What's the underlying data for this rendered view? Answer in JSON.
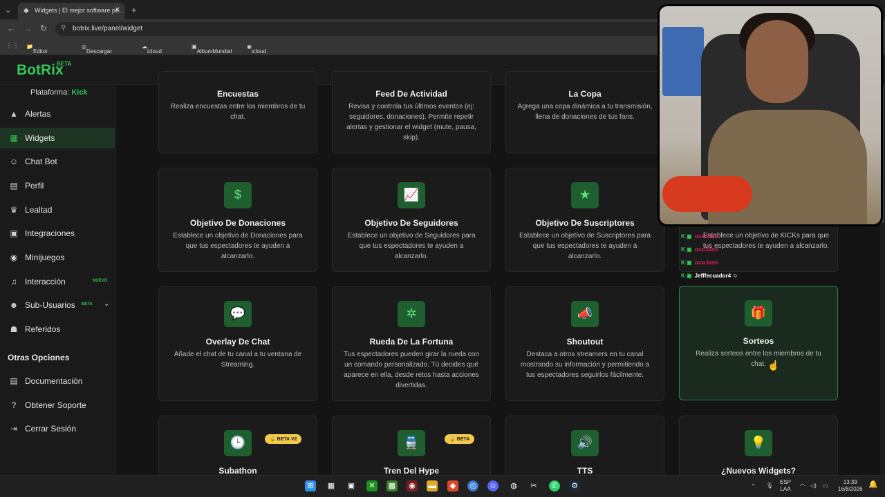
{
  "browser": {
    "tab_title": "Widgets | El mejor software pa…",
    "url": "botrix.live/panel/widget",
    "bookmarks": [
      "Editor de Fotos",
      "Descargar stream",
      "icloud correo",
      "AlbumMundial",
      "icloud photos"
    ]
  },
  "brand": {
    "name": "BotRix",
    "beta": "BETA"
  },
  "sidebar": {
    "platform_label": "Plataforma:",
    "platform_value": "Kick",
    "items": [
      {
        "label": "Alertas",
        "icon": "warning-icon"
      },
      {
        "label": "Widgets",
        "icon": "grid-icon"
      },
      {
        "label": "Chat Bot",
        "icon": "robot-icon"
      },
      {
        "label": "Perfil",
        "icon": "id-card-icon"
      },
      {
        "label": "Lealtad",
        "icon": "trophy-icon"
      },
      {
        "label": "Integraciones",
        "icon": "plug-icon"
      },
      {
        "label": "Minijuegos",
        "icon": "gamepad-icon"
      },
      {
        "label": "Interacción",
        "icon": "music-icon",
        "tag": "NUEVO"
      },
      {
        "label": "Sub-Usuarios",
        "icon": "users-icon",
        "tag": "BETA"
      },
      {
        "label": "Referidos",
        "icon": "user-group-icon"
      }
    ],
    "other_title": "Otras Opciones",
    "other_items": [
      {
        "label": "Documentación",
        "icon": "document-icon"
      },
      {
        "label": "Obtener Soporte",
        "icon": "help-icon"
      },
      {
        "label": "Cerrar Sesión",
        "icon": "logout-icon"
      }
    ]
  },
  "widgets": {
    "row0": [
      {
        "title": "Encuestas",
        "desc": "Realiza encuestas entre los miembros de tu chat."
      },
      {
        "title": "Feed De Actividad",
        "desc": "Revisa y controla tus últimos eventos (ej: seguidores, donaciones). Permite repetir alertas y gestionar el widget (mute, pausa, skip)."
      },
      {
        "title": "La Copa",
        "desc": "Agrega una copa dinámica a tu transmisión, llena de donaciones de tus fans."
      }
    ],
    "row1": [
      {
        "title": "Objetivo De Donaciones",
        "desc": "Establece un objetivo de Donaciones para que tus espectadores te ayuden a alcanzarlo.",
        "icon": "$"
      },
      {
        "title": "Objetivo De Seguidores",
        "desc": "Establece un objetivo de Seguidores para que tus espectadores te ayuden a alcanzarlo.",
        "icon": "📈"
      },
      {
        "title": "Objetivo De Suscriptores",
        "desc": "Establece un objetivo de Suscriptores para que tus espectadores te ayuden a alcanzarlo.",
        "icon": "★"
      }
    ],
    "row1_obscured_desc": "Establece un objetivo de KICKs para que tus espectadores te ayuden a alcanzarlo.",
    "row2": [
      {
        "title": "Overlay De Chat",
        "desc": "Añade el chat de tu canal a tu ventana de Streaming.",
        "icon": "💬"
      },
      {
        "title": "Rueda De La Fortuna",
        "desc": "Tus espectadores pueden girar la rueda con un comando personalizado. Tú decides qué aparece en ella, desde retos hasta acciones divertidas.",
        "icon": "✲"
      },
      {
        "title": "Shoutout",
        "desc": "Destaca a otros streamers en tu canal mostrando su información y permitiendo a tus espectadores seguirlos fácilmente.",
        "icon": "📣"
      },
      {
        "title": "Sorteos",
        "desc": "Realiza sorteos entre los miembros de tu chat.",
        "icon": "🎁"
      }
    ],
    "row3": [
      {
        "title": "Subathon",
        "badge": "🔒 BETA V2",
        "icon": "🕒"
      },
      {
        "title": "Tren Del Hype",
        "badge": "🔒 BETA",
        "icon": "🚆"
      },
      {
        "title": "TTS",
        "icon": "🔊"
      },
      {
        "title": "¿Nuevos Widgets?",
        "icon": "💡"
      }
    ]
  },
  "chat_overlay": {
    "names": [
      "oxxclash",
      "oxxclash",
      "oxxclash",
      "Jefffecuador4"
    ]
  },
  "taskbar": {
    "lang": "ESP",
    "lang2": "LAA",
    "time": "13:39",
    "date": "16/8/2026"
  },
  "colors": {
    "accent": "#34c759",
    "badge": "#f2c94c"
  }
}
